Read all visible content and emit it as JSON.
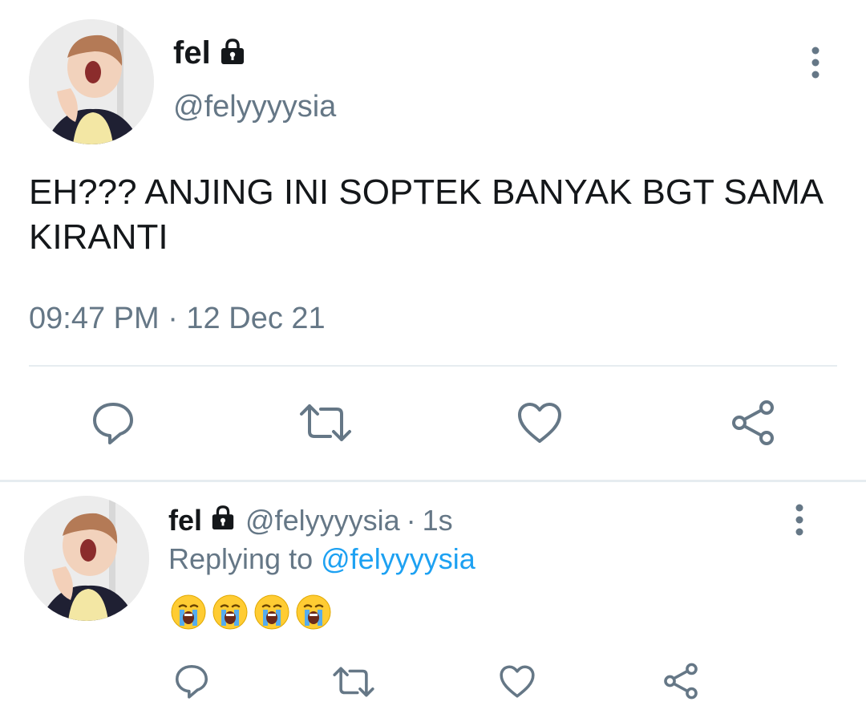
{
  "tweet": {
    "display_name": "fel",
    "handle": "@felyyyysia",
    "text": "EH??? ANJING INI SOPTEK BANYAK BGT SAMA KIRANTI",
    "timestamp": "09:47 PM · 12 Dec 21"
  },
  "reply": {
    "display_name": "fel",
    "handle": "@felyyyysia",
    "separator": "·",
    "time": "1s",
    "replying_prefix": "Replying to",
    "replying_to": "@felyyyysia",
    "emojis": [
      "😭",
      "😭",
      "😭",
      "😭"
    ]
  },
  "icons": {
    "lock": "lock-icon",
    "more": "more-vertical-icon",
    "reply": "comment-icon",
    "retweet": "retweet-icon",
    "like": "heart-icon",
    "share": "share-icon"
  },
  "colors": {
    "text_primary": "#14171a",
    "text_secondary": "#657786",
    "link": "#1da1f2",
    "divider": "#e6ecf0"
  }
}
